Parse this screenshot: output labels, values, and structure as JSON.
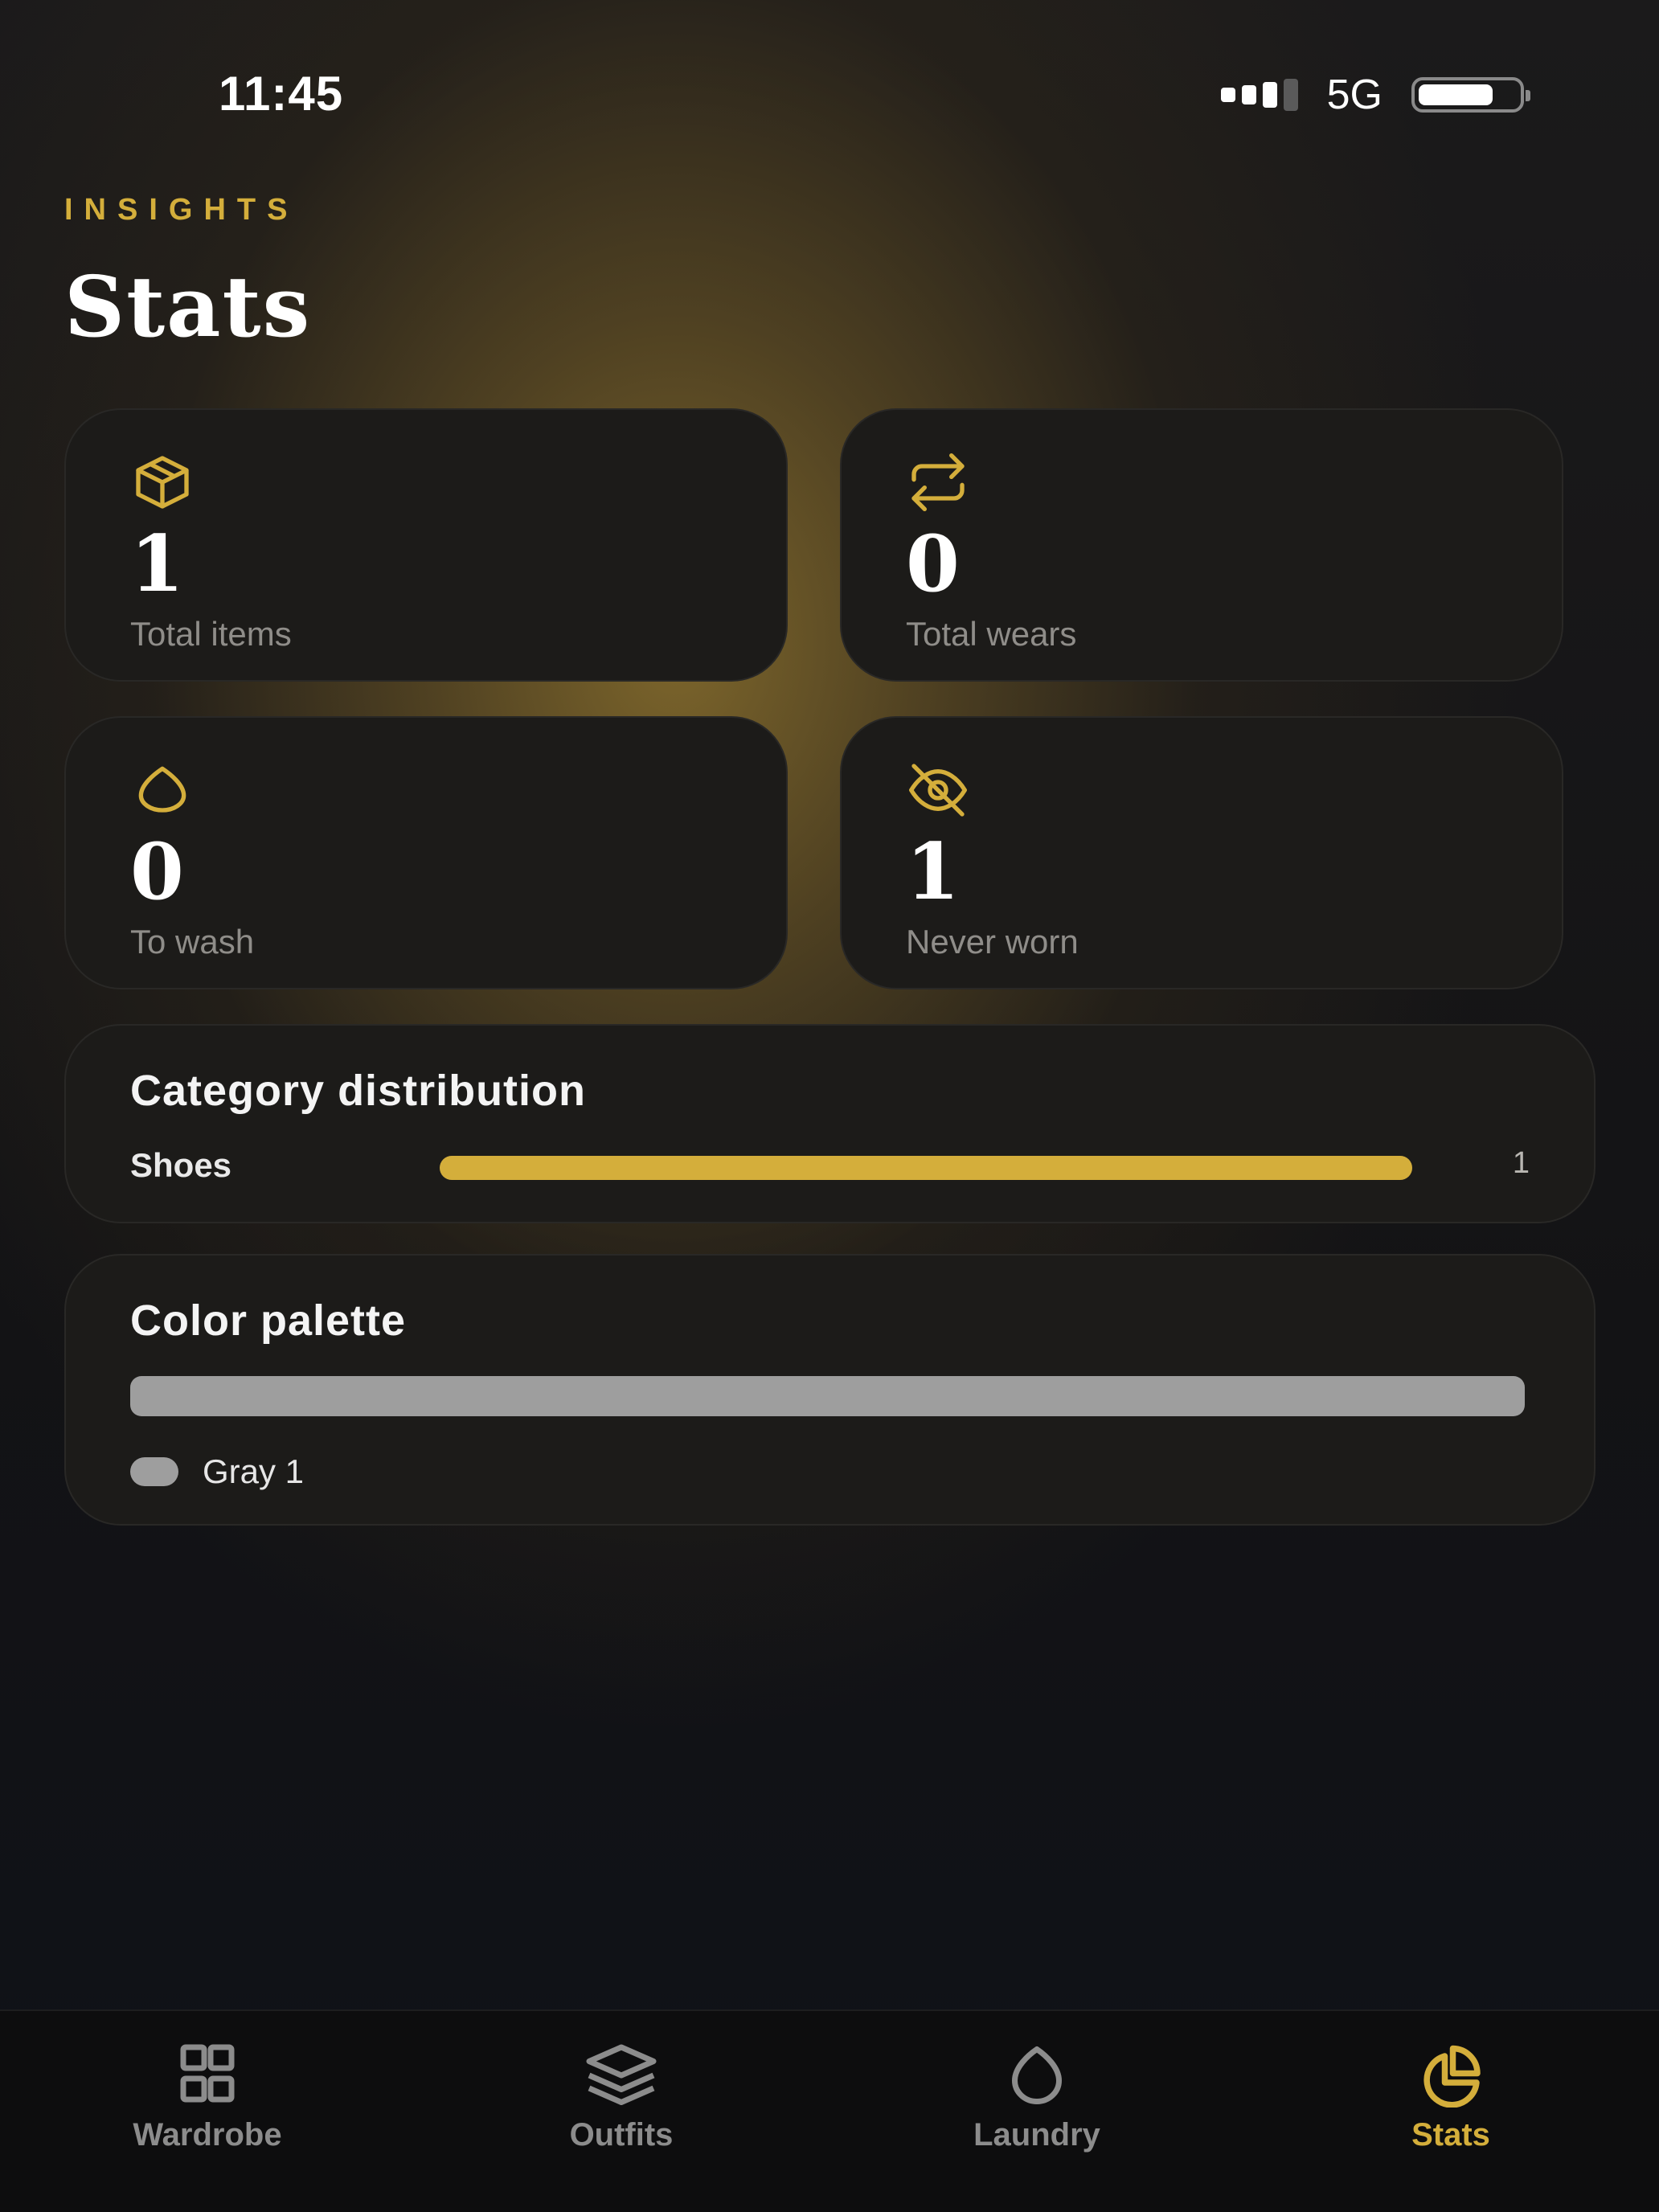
{
  "status_bar": {
    "time": "11:45",
    "network": "5G",
    "battery_level": 0.75
  },
  "header": {
    "eyebrow": "INSIGHTS",
    "title": "Stats"
  },
  "stats": [
    {
      "icon": "box-icon",
      "value": "1",
      "label": "Total items"
    },
    {
      "icon": "repeat-icon",
      "value": "0",
      "label": "Total wears"
    },
    {
      "icon": "droplet-icon",
      "value": "0",
      "label": "To wash"
    },
    {
      "icon": "eye-off-icon",
      "value": "1",
      "label": "Never worn"
    }
  ],
  "category_distribution": {
    "title": "Category distribution",
    "rows": [
      {
        "name": "Shoes",
        "count": "1",
        "fraction": 1.0
      }
    ]
  },
  "color_palette": {
    "title": "Color palette",
    "colors": [
      {
        "name": "Gray",
        "count": "1",
        "label": "Gray 1",
        "hex": "#9e9e9e",
        "fraction": 1.0
      }
    ]
  },
  "nav": {
    "items": [
      {
        "label": "Wardrobe",
        "icon": "grid-icon",
        "active": false
      },
      {
        "label": "Outfits",
        "icon": "layers-icon",
        "active": false
      },
      {
        "label": "Laundry",
        "icon": "droplet-icon",
        "active": false
      },
      {
        "label": "Stats",
        "icon": "pie-chart-icon",
        "active": true
      }
    ]
  },
  "colors": {
    "accent": "#d4ae3b",
    "card": "#1c1b19",
    "muted": "#8f8d89",
    "nav_inactive": "#8c8c8c"
  }
}
